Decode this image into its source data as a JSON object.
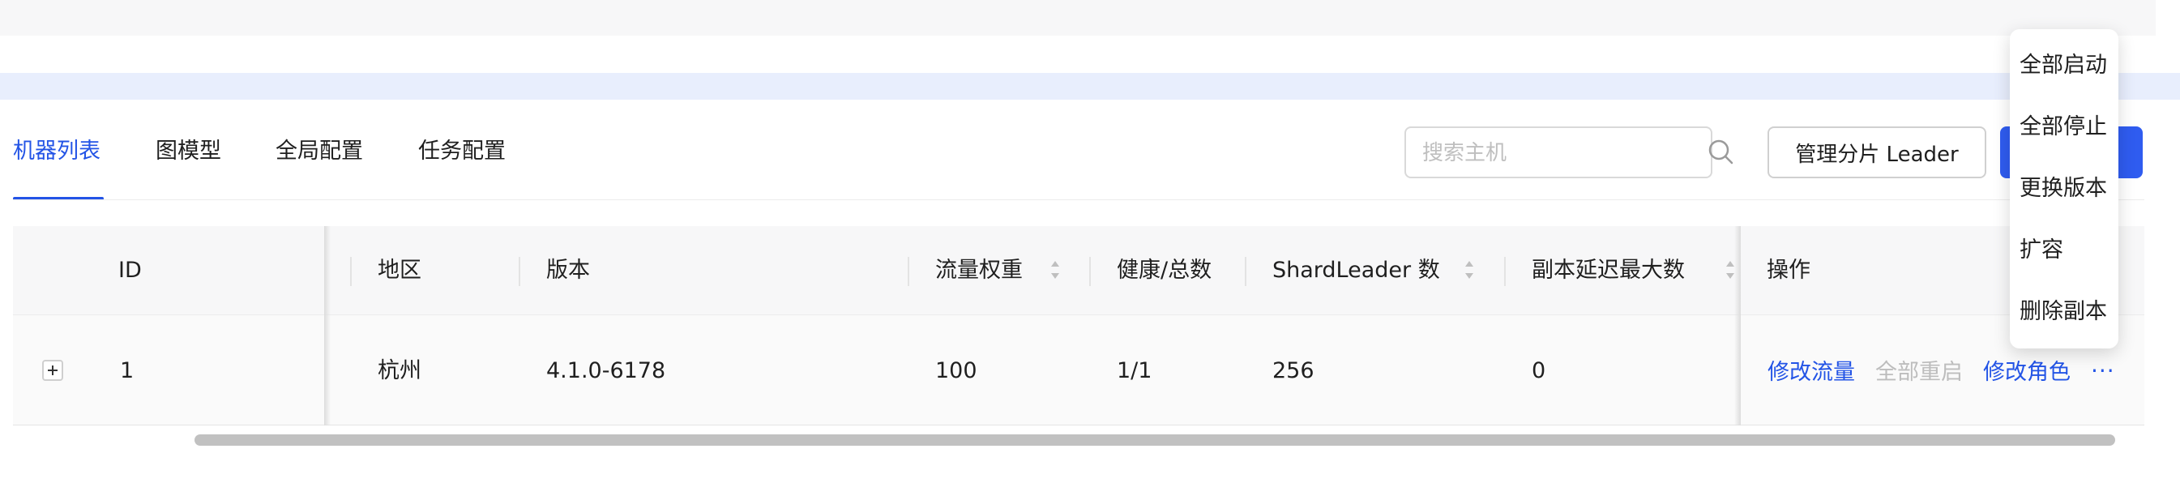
{
  "tabs": [
    {
      "label": "机器列表",
      "active": true
    },
    {
      "label": "图模型",
      "active": false
    },
    {
      "label": "全局配置",
      "active": false
    },
    {
      "label": "任务配置",
      "active": false
    }
  ],
  "toolbar": {
    "search_placeholder": "搜索主机",
    "manage_leader_label": "管理分片 Leader"
  },
  "table": {
    "columns": [
      "ID",
      "地区",
      "版本",
      "流量权重",
      "健康/总数",
      "ShardLeader 数",
      "副本延迟最大数",
      "操作"
    ],
    "rows": [
      {
        "id": "1",
        "region": "杭州",
        "version": "4.1.0-6178",
        "traffic_weight": "100",
        "health_total": "1/1",
        "shard_leader_count": "256",
        "replica_delay_max": "0",
        "actions": {
          "modify_traffic": "修改流量",
          "restart_all": "全部重启",
          "modify_role": "修改角色",
          "more": "···"
        }
      }
    ]
  },
  "dropdown_menu": {
    "items": [
      "全部启动",
      "全部停止",
      "更换版本",
      "扩容",
      "删除副本"
    ]
  },
  "colors": {
    "accent": "#2354e6",
    "primary_button": "#2f5cf0",
    "disabled_text": "#bdbdbd",
    "header_bg": "#f7f7f8",
    "band_bg": "#e8eefd"
  },
  "icons": {
    "search": "search-icon",
    "expand": "plus-square-icon",
    "sort": "sort-icon",
    "more": "ellipsis-icon"
  }
}
